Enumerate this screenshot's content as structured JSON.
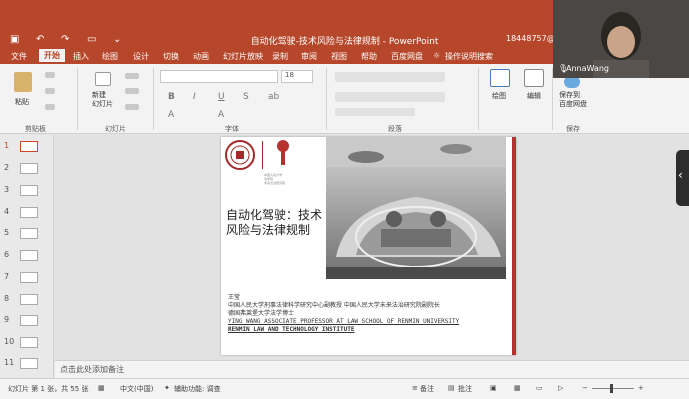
{
  "window": {
    "title": "自动化驾驶-技术风险与法律规制 - PowerPoint",
    "account": "18448757@qq.c"
  },
  "ribbon_tabs": [
    "文件",
    "开始",
    "插入",
    "绘图",
    "设计",
    "切换",
    "动画",
    "幻灯片放映",
    "录制",
    "审阅",
    "视图",
    "帮助",
    "百度网盘",
    "操作说明搜索"
  ],
  "ribbon": {
    "paste_label": "粘贴",
    "new_slide_label": "新建\n幻灯片",
    "font_size": "18",
    "draw_label": "绘图",
    "edit_label": "编辑",
    "save_baidu_label": "保存到\n百度网盘",
    "groups": {
      "clipboard": "剪贴板",
      "slides": "幻灯片",
      "font": "字体",
      "paragraph": "段落",
      "save": "保存"
    }
  },
  "thumbnails": [
    "1",
    "2",
    "3",
    "4",
    "5",
    "6",
    "7",
    "8",
    "9",
    "10",
    "11"
  ],
  "slide": {
    "title_line1": "自动化驾驶：技术",
    "title_line2": "风险与法律规制",
    "logo_text": "中国人民大学\n法学院\n未来法治研究院",
    "author_name": "王莹",
    "author_line1": "中国人民大学刑事法律科学研究中心副教授  中国人民大学未来法治研究院副院长",
    "author_line2": "德国弗莱堡大学法学博士",
    "author_en_line1": "YING WANG ASSOCIATE PROFESSOR AT LAW SCHOOL OF RENMIN UNIVERSITY",
    "author_en_line2": "RENMIN LAW AND TECHNOLOGY INSTITUTE"
  },
  "notes_placeholder": "点击此处添加备注",
  "status": {
    "slide_count": "幻灯片 第 1 张，共 55 张",
    "language": "中文(中国)",
    "accessibility": "辅助功能: 调查",
    "notes_btn": "备注",
    "comments_btn": "批注"
  },
  "video": {
    "participant_name": "AnnaWang"
  },
  "colors": {
    "brand": "#b7472a",
    "accent_red": "#b7322e"
  }
}
